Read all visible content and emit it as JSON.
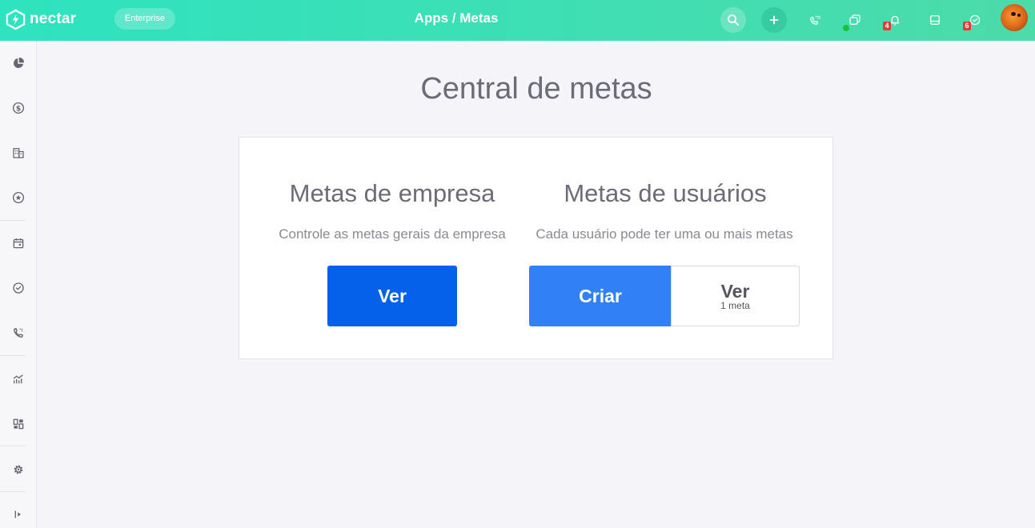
{
  "header": {
    "logo_text": "nectar",
    "plan_badge": "Enterprise",
    "breadcrumb": "Apps / Metas",
    "icons": [
      "search-icon",
      "plus-icon",
      "phone-dialpad-icon",
      "copy-icon",
      "bell-icon",
      "inbox-icon",
      "check-circle-icon"
    ],
    "bell_count": "4",
    "tasks_count": "6",
    "online_status_color": "#19c23c"
  },
  "sidebar": {
    "items": [
      "dashboard-pie-icon",
      "dollar-icon",
      "building-icon",
      "star-icon",
      "calendar-icon",
      "check-circle-icon",
      "phone-icon",
      "chart-icon",
      "widgets-icon",
      "settings-icon",
      "expand-icon"
    ]
  },
  "main": {
    "title": "Central de metas",
    "company": {
      "title": "Metas de empresa",
      "description": "Controle as metas gerais da empresa",
      "view_button": "Ver"
    },
    "users": {
      "title": "Metas de usuários",
      "description": "Cada usuário pode ter uma ou mais metas",
      "create_button": "Criar",
      "view_button": "Ver",
      "view_count": "1 meta"
    }
  },
  "colors": {
    "header_gradient_start": "#2ee3c0",
    "header_gradient_end": "#4cdba9",
    "primary_button": "#0560ea",
    "create_button": "#3180f6",
    "badge_red": "#e53935"
  }
}
